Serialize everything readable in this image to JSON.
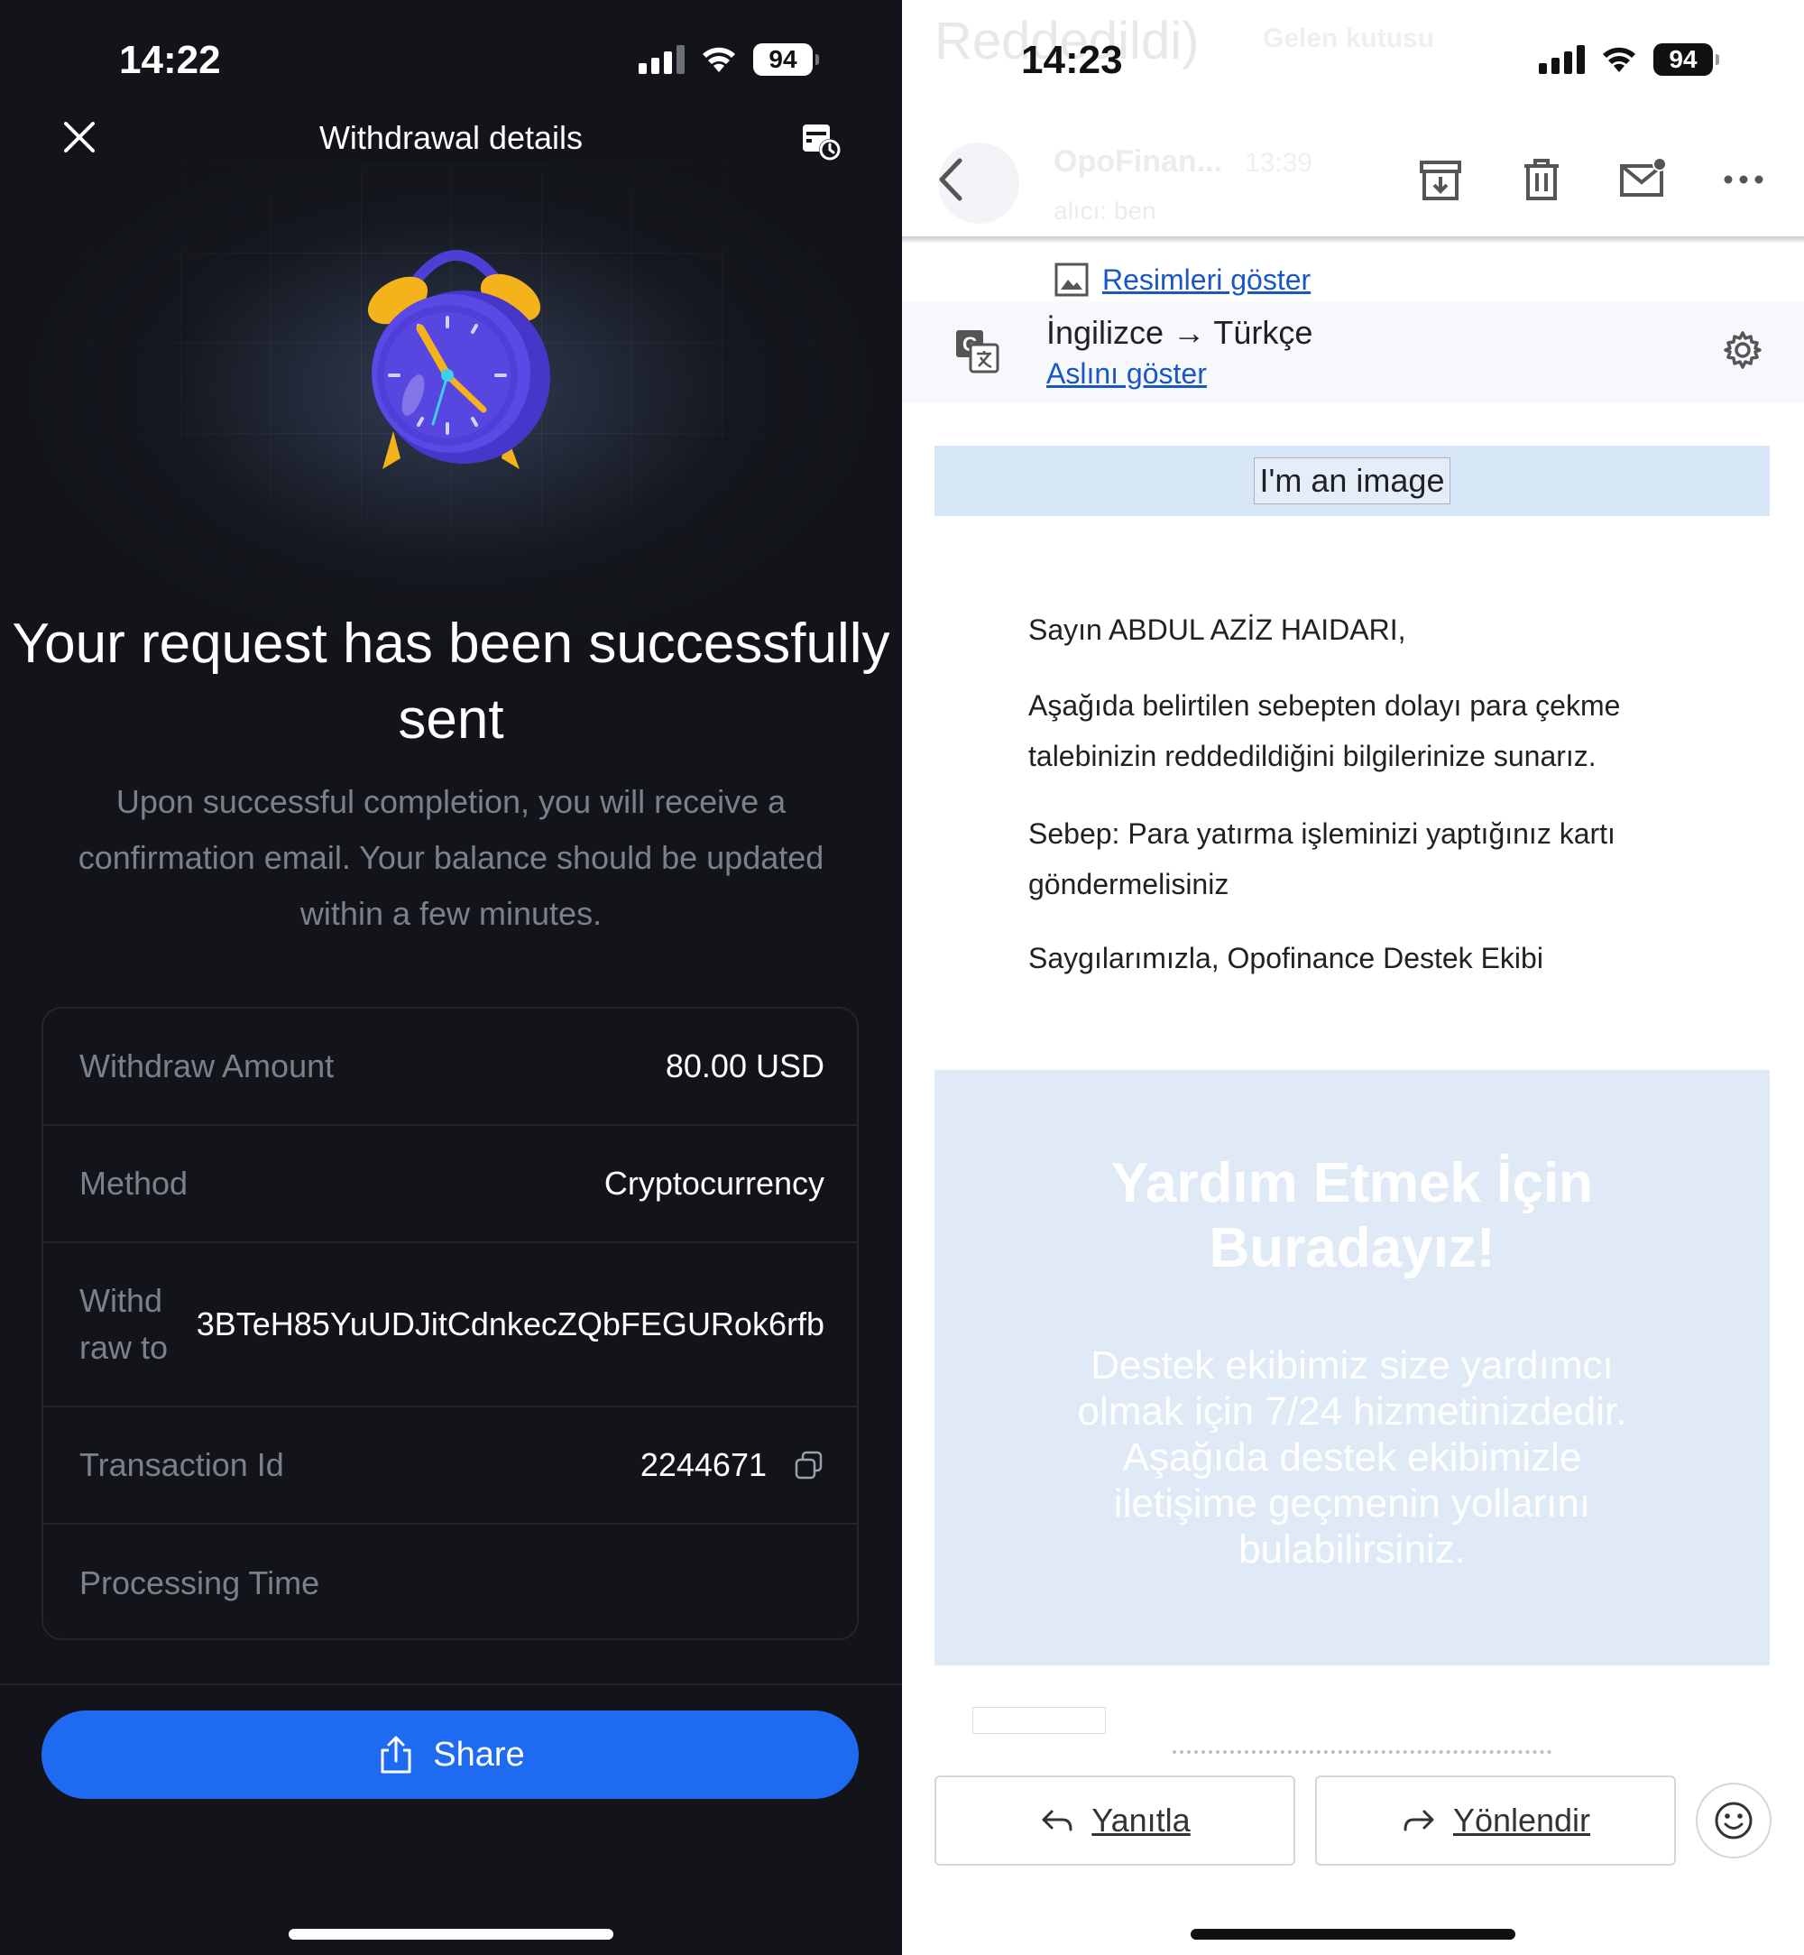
{
  "left_screen": {
    "status": {
      "time": "14:22",
      "battery": "94"
    },
    "header": {
      "title": "Withdrawal details"
    },
    "headline": "Your request has been successfully sent",
    "subtext": "Upon successful completion, you will receive a confirmation email. Your balance should be updated within a few minutes.",
    "details": {
      "amount_label": "Withdraw Amount",
      "amount_value": "80.00 USD",
      "method_label": "Method",
      "method_value": "Cryptocurrency",
      "address_label": "Withd raw to",
      "address_value": "3BTeH85YuUDJitCdnkecZQbFEGURok6rfb",
      "txn_label": "Transaction Id",
      "txn_value": "2244671",
      "processing_label": "Processing Time",
      "processing_value": ""
    },
    "share_label": "Share",
    "colors": {
      "background": "#121419",
      "accent": "#1e6bf2",
      "muted": "#7b818c"
    }
  },
  "right_screen": {
    "status": {
      "time": "14:23",
      "battery": "94"
    },
    "ghost": {
      "subject": "Reddedildi)",
      "label": "Gelen kutusu",
      "sender": "OpoFinan...",
      "time": "13:39",
      "to": "alıcı: ben"
    },
    "show_images": "Resimleri göster",
    "translation": {
      "langs": "İngilizce → Türkçe",
      "show_original": "Aslını göster"
    },
    "image_placeholder": "I'm an image",
    "email": {
      "greeting": "Sayın ABDUL AZİZ HAIDARI,",
      "p1": "Aşağıda belirtilen sebepten dolayı para çekme talebinizin reddedildiğini bilgilerinize sunarız.",
      "p2": "Sebep: Para yatırma işleminizi yaptığınız kartı göndermelisiniz",
      "sign": "Saygılarımızla, Opofinance Destek Ekibi"
    },
    "help": {
      "title": "Yardım Etmek İçin Buradayız!",
      "text": "Destek ekibimiz size yardımcı olmak için 7/24 hizmetinizdedir. Aşağıda destek ekibimizle iletişime geçmenin yollarını bulabilirsiniz."
    },
    "actions": {
      "reply": "Yanıtla",
      "forward": "Yönlendir"
    },
    "colors": {
      "link": "#1a56c4",
      "panel": "#dfeaf6"
    }
  }
}
